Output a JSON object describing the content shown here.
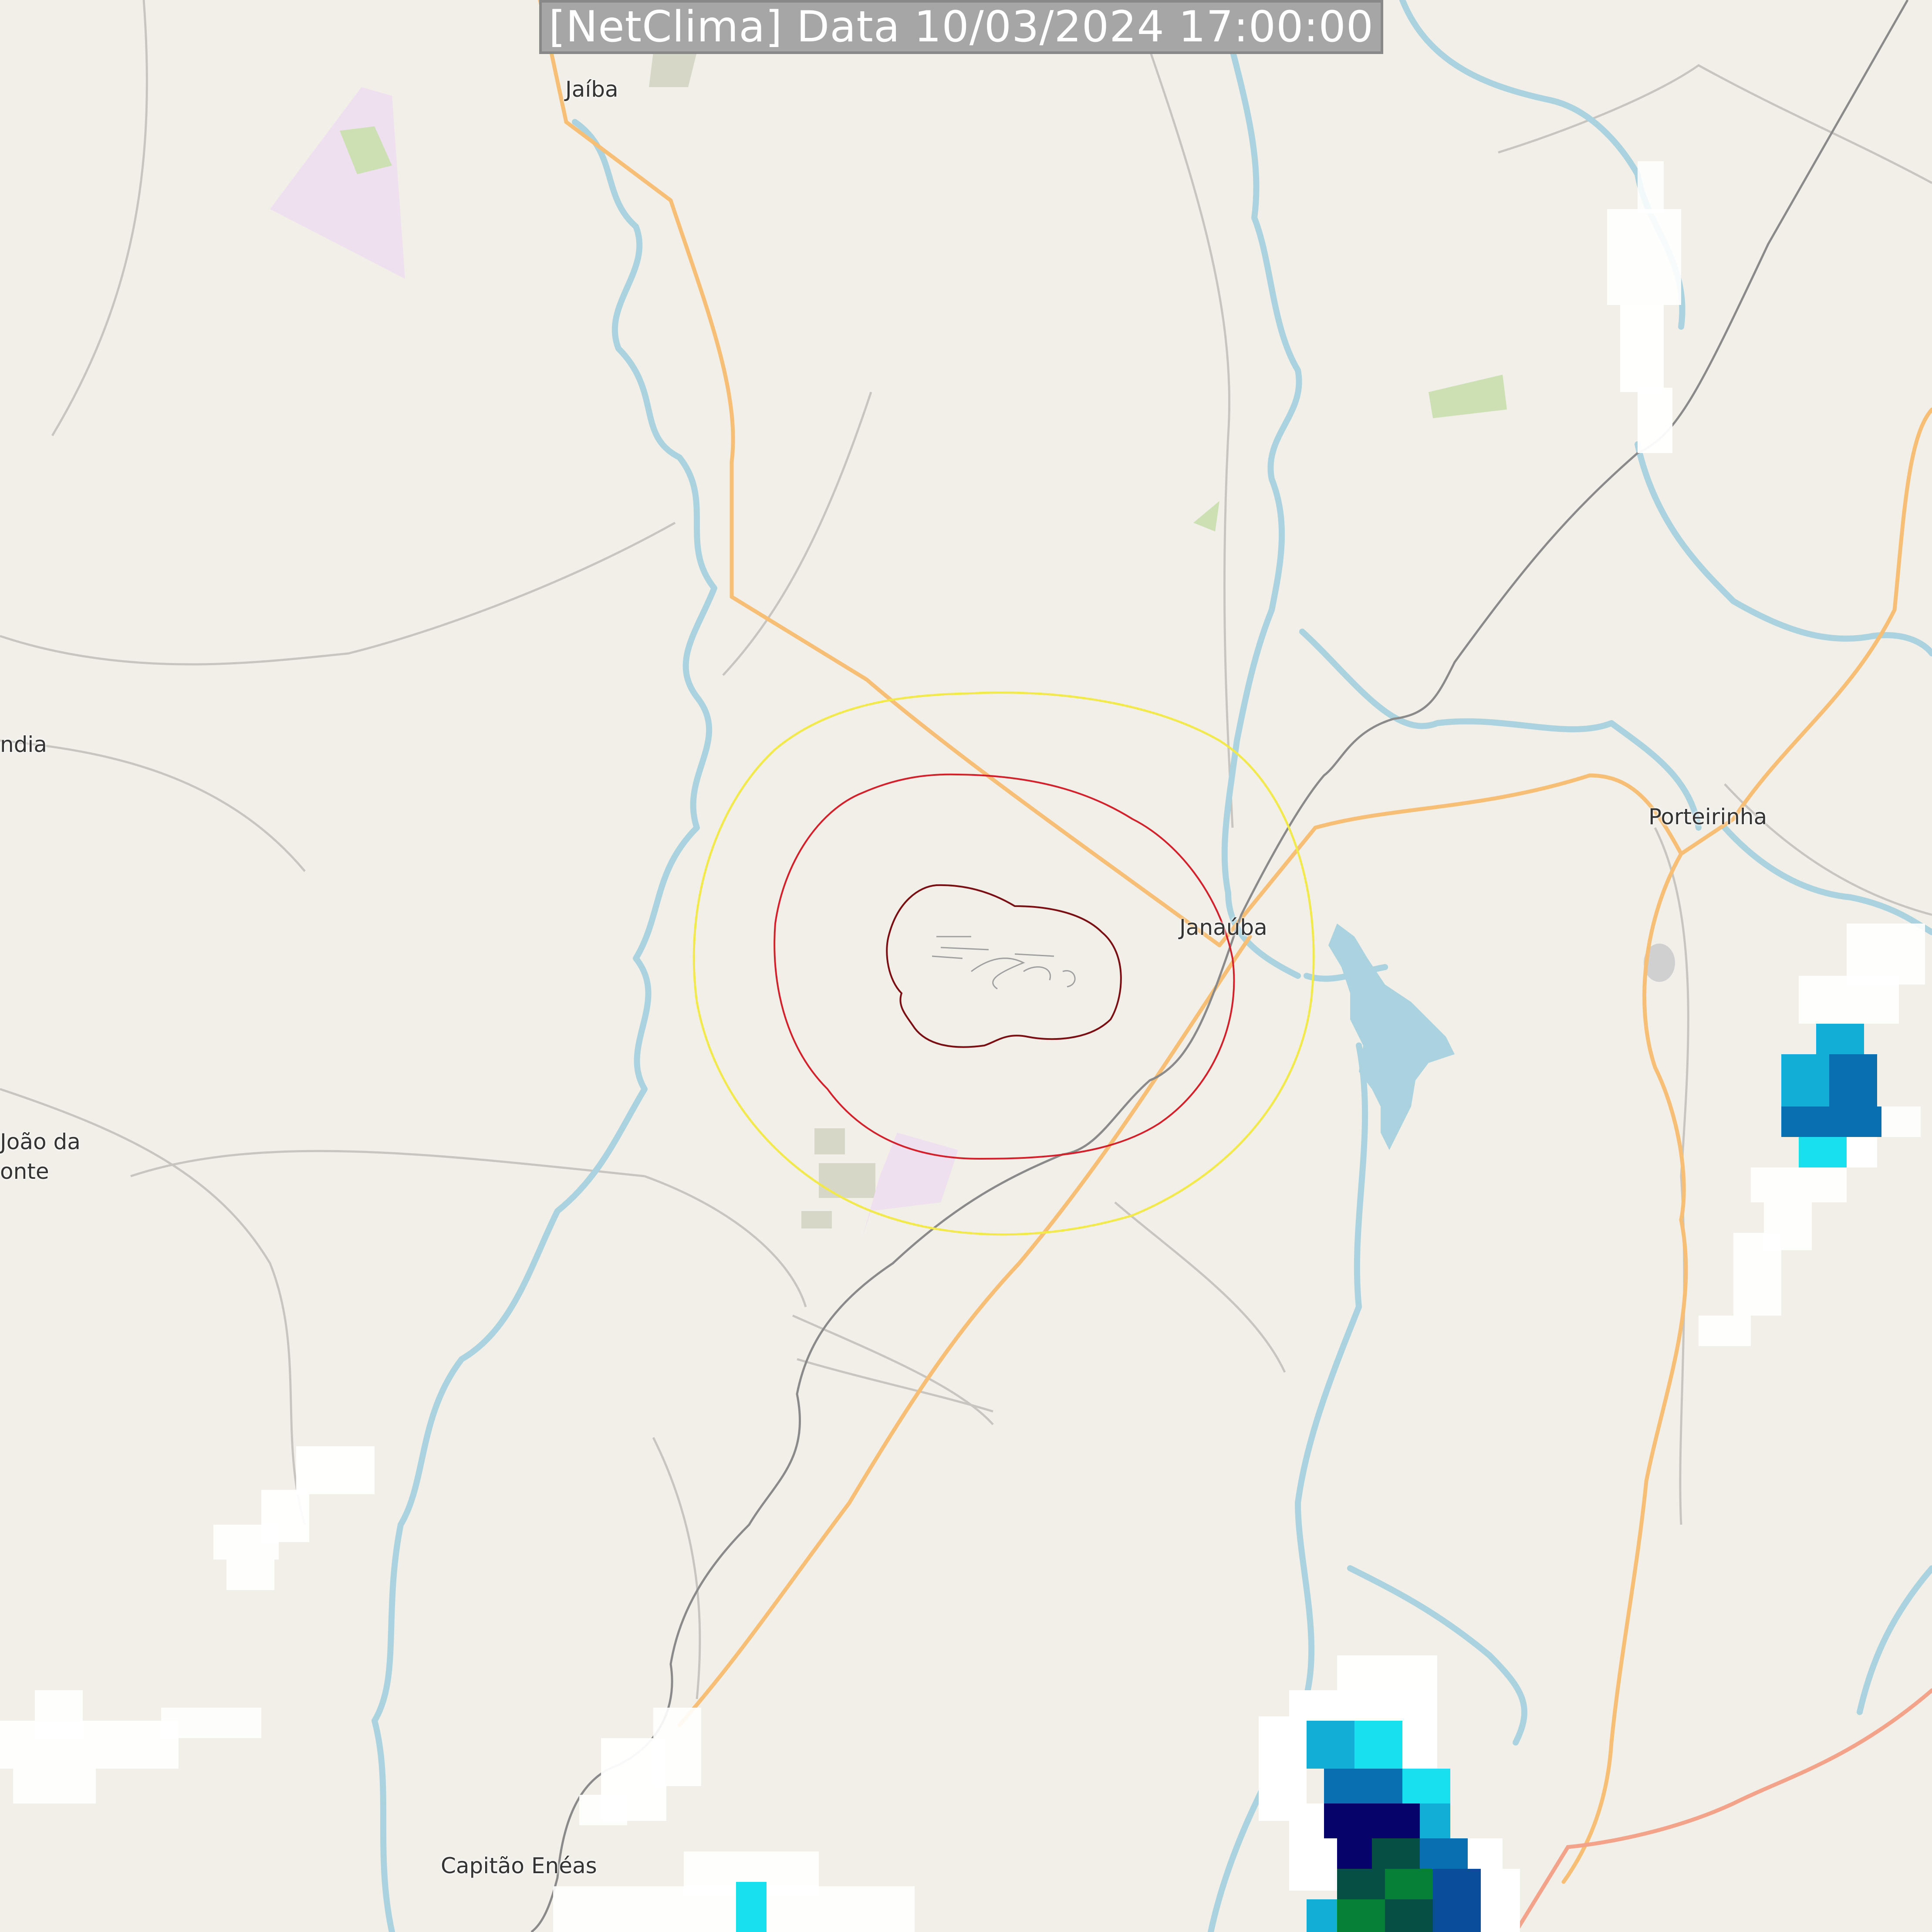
{
  "banner": {
    "text": "[NetClima] Data 10/03/2024 17:00:00"
  },
  "places": [
    {
      "id": "jaiba",
      "label": "Jaíba"
    },
    {
      "id": "janauba",
      "label": "Janaúba"
    },
    {
      "id": "porteirinha",
      "label": "Porteirinha"
    },
    {
      "id": "capitao-eneas",
      "label": "Capitão Enéas"
    },
    {
      "id": "ndia",
      "label": "ndia"
    },
    {
      "id": "joao-da",
      "label": "João da"
    },
    {
      "id": "onte",
      "label": "onte"
    }
  ],
  "colors": {
    "land": "#f2efe9",
    "water": "#aad3df",
    "primary_road": "#f6bf75",
    "trunk_road": "#f3a38a",
    "railway": "#8a8a8a",
    "minor_road": "#c8c4bf",
    "ring_outer": "#f2e94a",
    "ring_middle": "#d4202a",
    "ring_inner": "#7a0e12",
    "radar_light": "#ffffff",
    "radar_cyan": "#18e0ee",
    "radar_teal": "#12aed6",
    "radar_blue": "#0a6fb0",
    "radar_navy": "#06046a",
    "radar_darkgreen": "#064f44",
    "radar_green": "#058036"
  }
}
